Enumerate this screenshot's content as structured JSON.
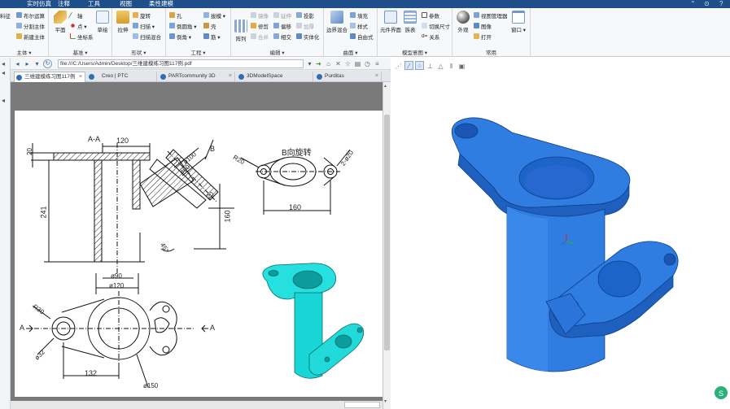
{
  "menubar": {
    "items": [
      "实时仿真",
      "注释",
      "工具",
      "视图",
      "柔性建模"
    ],
    "window_controls": [
      "⌃",
      "⊙",
      "?"
    ]
  },
  "ribbon": {
    "groups": {
      "body": {
        "label": "主体 ▾",
        "items": [
          "布尔运算",
          "分割主体",
          "新建主体"
        ],
        "cut_label": "料征"
      },
      "datum": {
        "label": "基准 ▾",
        "items": [
          "轴",
          "点 ▾",
          "坐标系"
        ],
        "plane": "平面",
        "sketch": "草绘"
      },
      "shapes": {
        "label": "形状 ▾",
        "extrude": "拉伸",
        "items": [
          "旋转",
          "扫描 ▾",
          "扫描混合"
        ]
      },
      "engineering": {
        "label": "工程 ▾",
        "items": [
          "孔",
          "倒圆角 ▾",
          "倒角 ▾",
          "拔模 ▾",
          "壳",
          "筋 ▾"
        ]
      },
      "editing": {
        "label": "编辑 ▾",
        "pattern": "阵列",
        "items": [
          "镜像",
          "延伸",
          "投影",
          "修剪",
          "偏移",
          "加厚",
          "合并",
          "相交",
          "实体化"
        ]
      },
      "surfaces": {
        "label": "曲面 ▾",
        "freestyle": "边界混合",
        "items": [
          "填充",
          "样式",
          "自由式"
        ]
      },
      "model_intent": {
        "label": "模型意图 ▾",
        "items": [
          "元件界面",
          "族表",
          "参数",
          "切换尺寸",
          "关系"
        ],
        "d_prefix": "d="
      },
      "common": {
        "label": "常用",
        "appearance": "外观",
        "items": [
          "视图管理器",
          "图像",
          "打开"
        ],
        "window": "窗口 ▾"
      }
    }
  },
  "browser": {
    "address": "file:///C:/Users/Admin/Desktop/三维建模练习图117例.pdf",
    "tabs": [
      {
        "label": "三维建模练习图117例",
        "active": true
      },
      {
        "label": "Creo | PTC",
        "active": false
      },
      {
        "label": "PARTcommunity 3D",
        "active": false
      },
      {
        "label": "3DModelSpace",
        "active": false
      },
      {
        "label": "Purditas",
        "active": false
      }
    ]
  },
  "drawing": {
    "section_label": "A-A",
    "rotation_label": "B向旋转",
    "view_letter_b": "B",
    "view_letter_a": "A",
    "dims": [
      "20",
      "120",
      "241",
      "ø100",
      "ø60",
      "20",
      "160",
      "45°",
      "ø90",
      "ø120",
      "R20",
      "2-ø20",
      "160",
      "R30",
      "ø32",
      "132",
      "ø150"
    ]
  },
  "colors": {
    "menubar": "#1e4f8a",
    "model_blue": "#2f7de1",
    "preview_cyan": "#19d6d6"
  }
}
